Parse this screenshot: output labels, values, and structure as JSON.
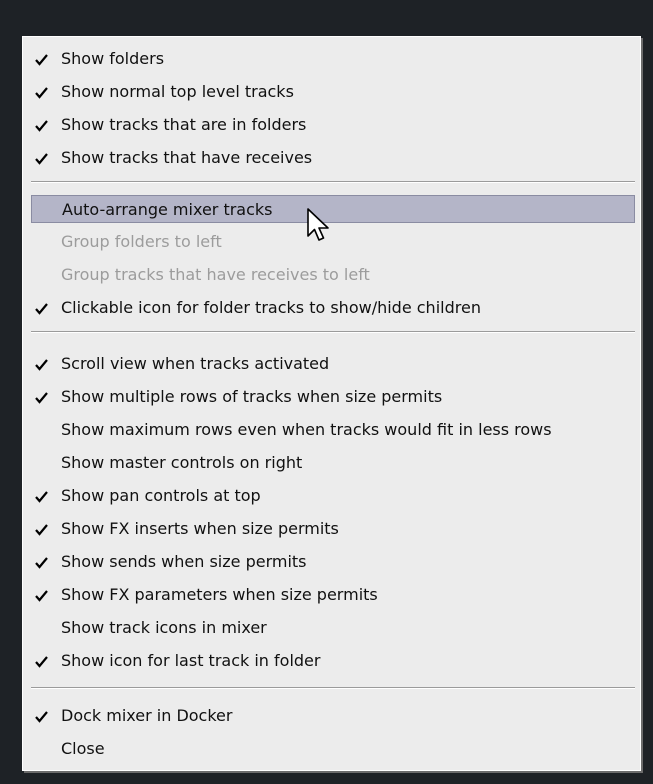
{
  "menu": {
    "section1": [
      {
        "label": "Show folders",
        "checked": true
      },
      {
        "label": "Show normal top level tracks",
        "checked": true
      },
      {
        "label": "Show tracks that are in folders",
        "checked": true
      },
      {
        "label": "Show tracks that have receives",
        "checked": true
      }
    ],
    "section2": [
      {
        "label": "Auto-arrange mixer tracks",
        "checked": false,
        "highlighted": true
      },
      {
        "label": "Group folders to left",
        "checked": false,
        "disabled": true
      },
      {
        "label": "Group tracks that have receives to left",
        "checked": false,
        "disabled": true
      },
      {
        "label": "Clickable icon for folder tracks to show/hide children",
        "checked": true
      }
    ],
    "section3": [
      {
        "label": "Scroll view when tracks activated",
        "checked": true
      },
      {
        "label": "Show multiple rows of tracks when size permits",
        "checked": true
      },
      {
        "label": "Show maximum rows even when tracks would fit in less rows",
        "checked": false
      },
      {
        "label": "Show master controls on right",
        "checked": false
      },
      {
        "label": "Show pan controls at top",
        "checked": true
      },
      {
        "label": "Show FX inserts when size permits",
        "checked": true
      },
      {
        "label": "Show sends when size permits",
        "checked": true
      },
      {
        "label": "Show FX parameters when size permits",
        "checked": true
      },
      {
        "label": "Show track icons in mixer",
        "checked": false
      },
      {
        "label": "Show icon for last track in folder",
        "checked": true
      }
    ],
    "section4": [
      {
        "label": "Dock mixer in Docker",
        "checked": true
      },
      {
        "label": "Close",
        "checked": false
      }
    ]
  },
  "colors": {
    "menu_background": "#ececec",
    "highlight": "#b4b5c8",
    "disabled_text": "#9c9c9c",
    "window_background": "#1e2226"
  },
  "icons": {
    "check": "checkmark-icon",
    "cursor": "mouse-pointer-icon"
  }
}
